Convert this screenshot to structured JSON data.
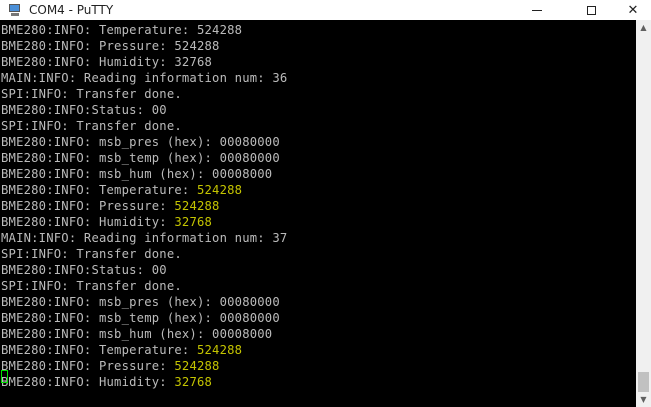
{
  "window": {
    "title": "COM4 - PuTTY",
    "close_glyph": "✕",
    "minimize_icon": "minimize-icon",
    "maximize_icon": "maximize-icon",
    "close_icon": "close-icon"
  },
  "colors": {
    "text": "#bbbbbb",
    "value_highlight": "#c4c400",
    "background": "#000000",
    "cursor": "#00e000"
  },
  "scrollbar": {
    "up_glyph": "▲",
    "down_glyph": "▼"
  },
  "terminal": {
    "lines": [
      {
        "text": "BME280:INFO: Temperature: ",
        "value": "524288",
        "highlight": false
      },
      {
        "text": "BME280:INFO: Pressure: ",
        "value": "524288",
        "highlight": false
      },
      {
        "text": "BME280:INFO: Humidity: ",
        "value": "32768",
        "highlight": false
      },
      {
        "text": "MAIN:INFO: Reading information num: 36",
        "value": "",
        "highlight": false
      },
      {
        "text": "SPI:INFO: Transfer done.",
        "value": "",
        "highlight": false
      },
      {
        "text": "BME280:INFO:Status: 00",
        "value": "",
        "highlight": false
      },
      {
        "text": "SPI:INFO: Transfer done.",
        "value": "",
        "highlight": false
      },
      {
        "text": "BME280:INFO: msb_pres (hex): 00080000",
        "value": "",
        "highlight": false
      },
      {
        "text": "BME280:INFO: msb_temp (hex): 00080000",
        "value": "",
        "highlight": false
      },
      {
        "text": "BME280:INFO: msb_hum (hex): 00008000",
        "value": "",
        "highlight": false
      },
      {
        "text": "BME280:INFO: Temperature: ",
        "value": "524288",
        "highlight": true
      },
      {
        "text": "BME280:INFO: Pressure: ",
        "value": "524288",
        "highlight": true
      },
      {
        "text": "BME280:INFO: Humidity: ",
        "value": "32768",
        "highlight": true
      },
      {
        "text": "MAIN:INFO: Reading information num: 37",
        "value": "",
        "highlight": false
      },
      {
        "text": "SPI:INFO: Transfer done.",
        "value": "",
        "highlight": false
      },
      {
        "text": "BME280:INFO:Status: 00",
        "value": "",
        "highlight": false
      },
      {
        "text": "SPI:INFO: Transfer done.",
        "value": "",
        "highlight": false
      },
      {
        "text": "BME280:INFO: msb_pres (hex): 00080000",
        "value": "",
        "highlight": false
      },
      {
        "text": "BME280:INFO: msb_temp (hex): 00080000",
        "value": "",
        "highlight": false
      },
      {
        "text": "BME280:INFO: msb_hum (hex): 00008000",
        "value": "",
        "highlight": false
      },
      {
        "text": "BME280:INFO: Temperature: ",
        "value": "524288",
        "highlight": true
      },
      {
        "text": "BME280:INFO: Pressure: ",
        "value": "524288",
        "highlight": true
      },
      {
        "text": "BME280:INFO: Humidity: ",
        "value": "32768",
        "highlight": true
      }
    ]
  }
}
